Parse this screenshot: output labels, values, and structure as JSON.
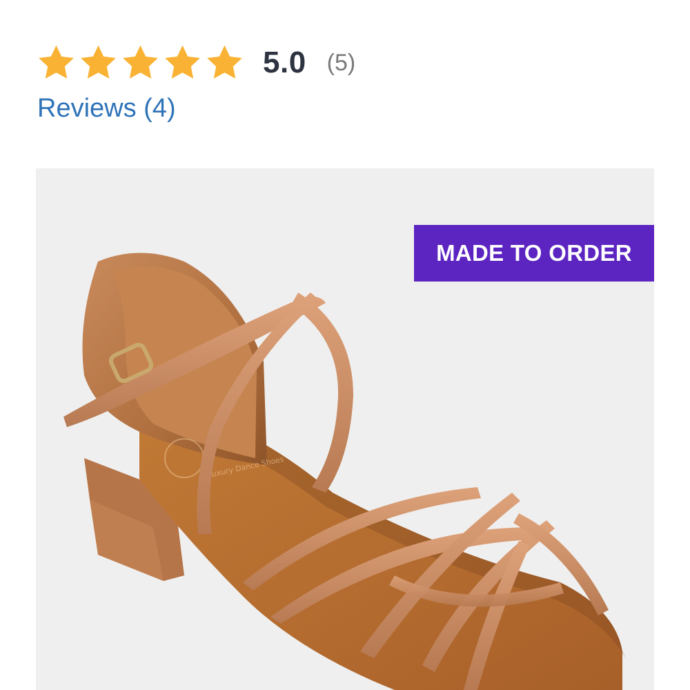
{
  "rating": {
    "score": "5.0",
    "count": "(5)",
    "stars": 5,
    "star_color": "#F9B233"
  },
  "reviews_link": {
    "label": "Reviews (4)",
    "color": "#2F73B8"
  },
  "product_image": {
    "alt": "tan satin strappy dance sandal",
    "icon": "shoe-image"
  },
  "badge": {
    "label": "MADE TO ORDER",
    "color": "#5C24C0"
  },
  "brand_text": "Luxury Dance Shoes"
}
